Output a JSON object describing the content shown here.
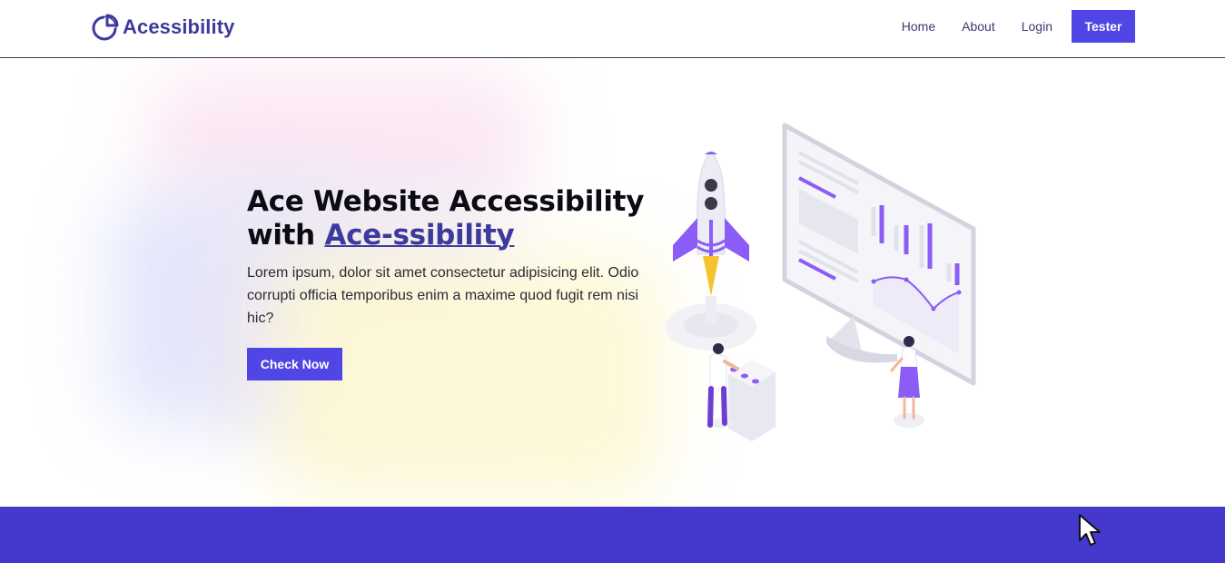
{
  "nav": {
    "brand": "Acessibility",
    "brand_icon": "pie-chart-icon",
    "links": [
      "Home",
      "About",
      "Login"
    ],
    "cta_label": "Tester"
  },
  "hero": {
    "title_prefix": "Ace Website Accessibility",
    "title_with": "with",
    "title_accent": "Ace-ssibility",
    "description": "Lorem ipsum, dolor sit amet consectetur adipisicing elit. Odio corrupti officia temporibus enim a maxime quod fugit rem nisi hic?",
    "cta_label": "Check Now",
    "illustration": "rocket-launch-dashboard-illustration"
  },
  "colors": {
    "primary": "#4f46e5",
    "brand": "#3d3a9f",
    "band": "#4538cc"
  }
}
